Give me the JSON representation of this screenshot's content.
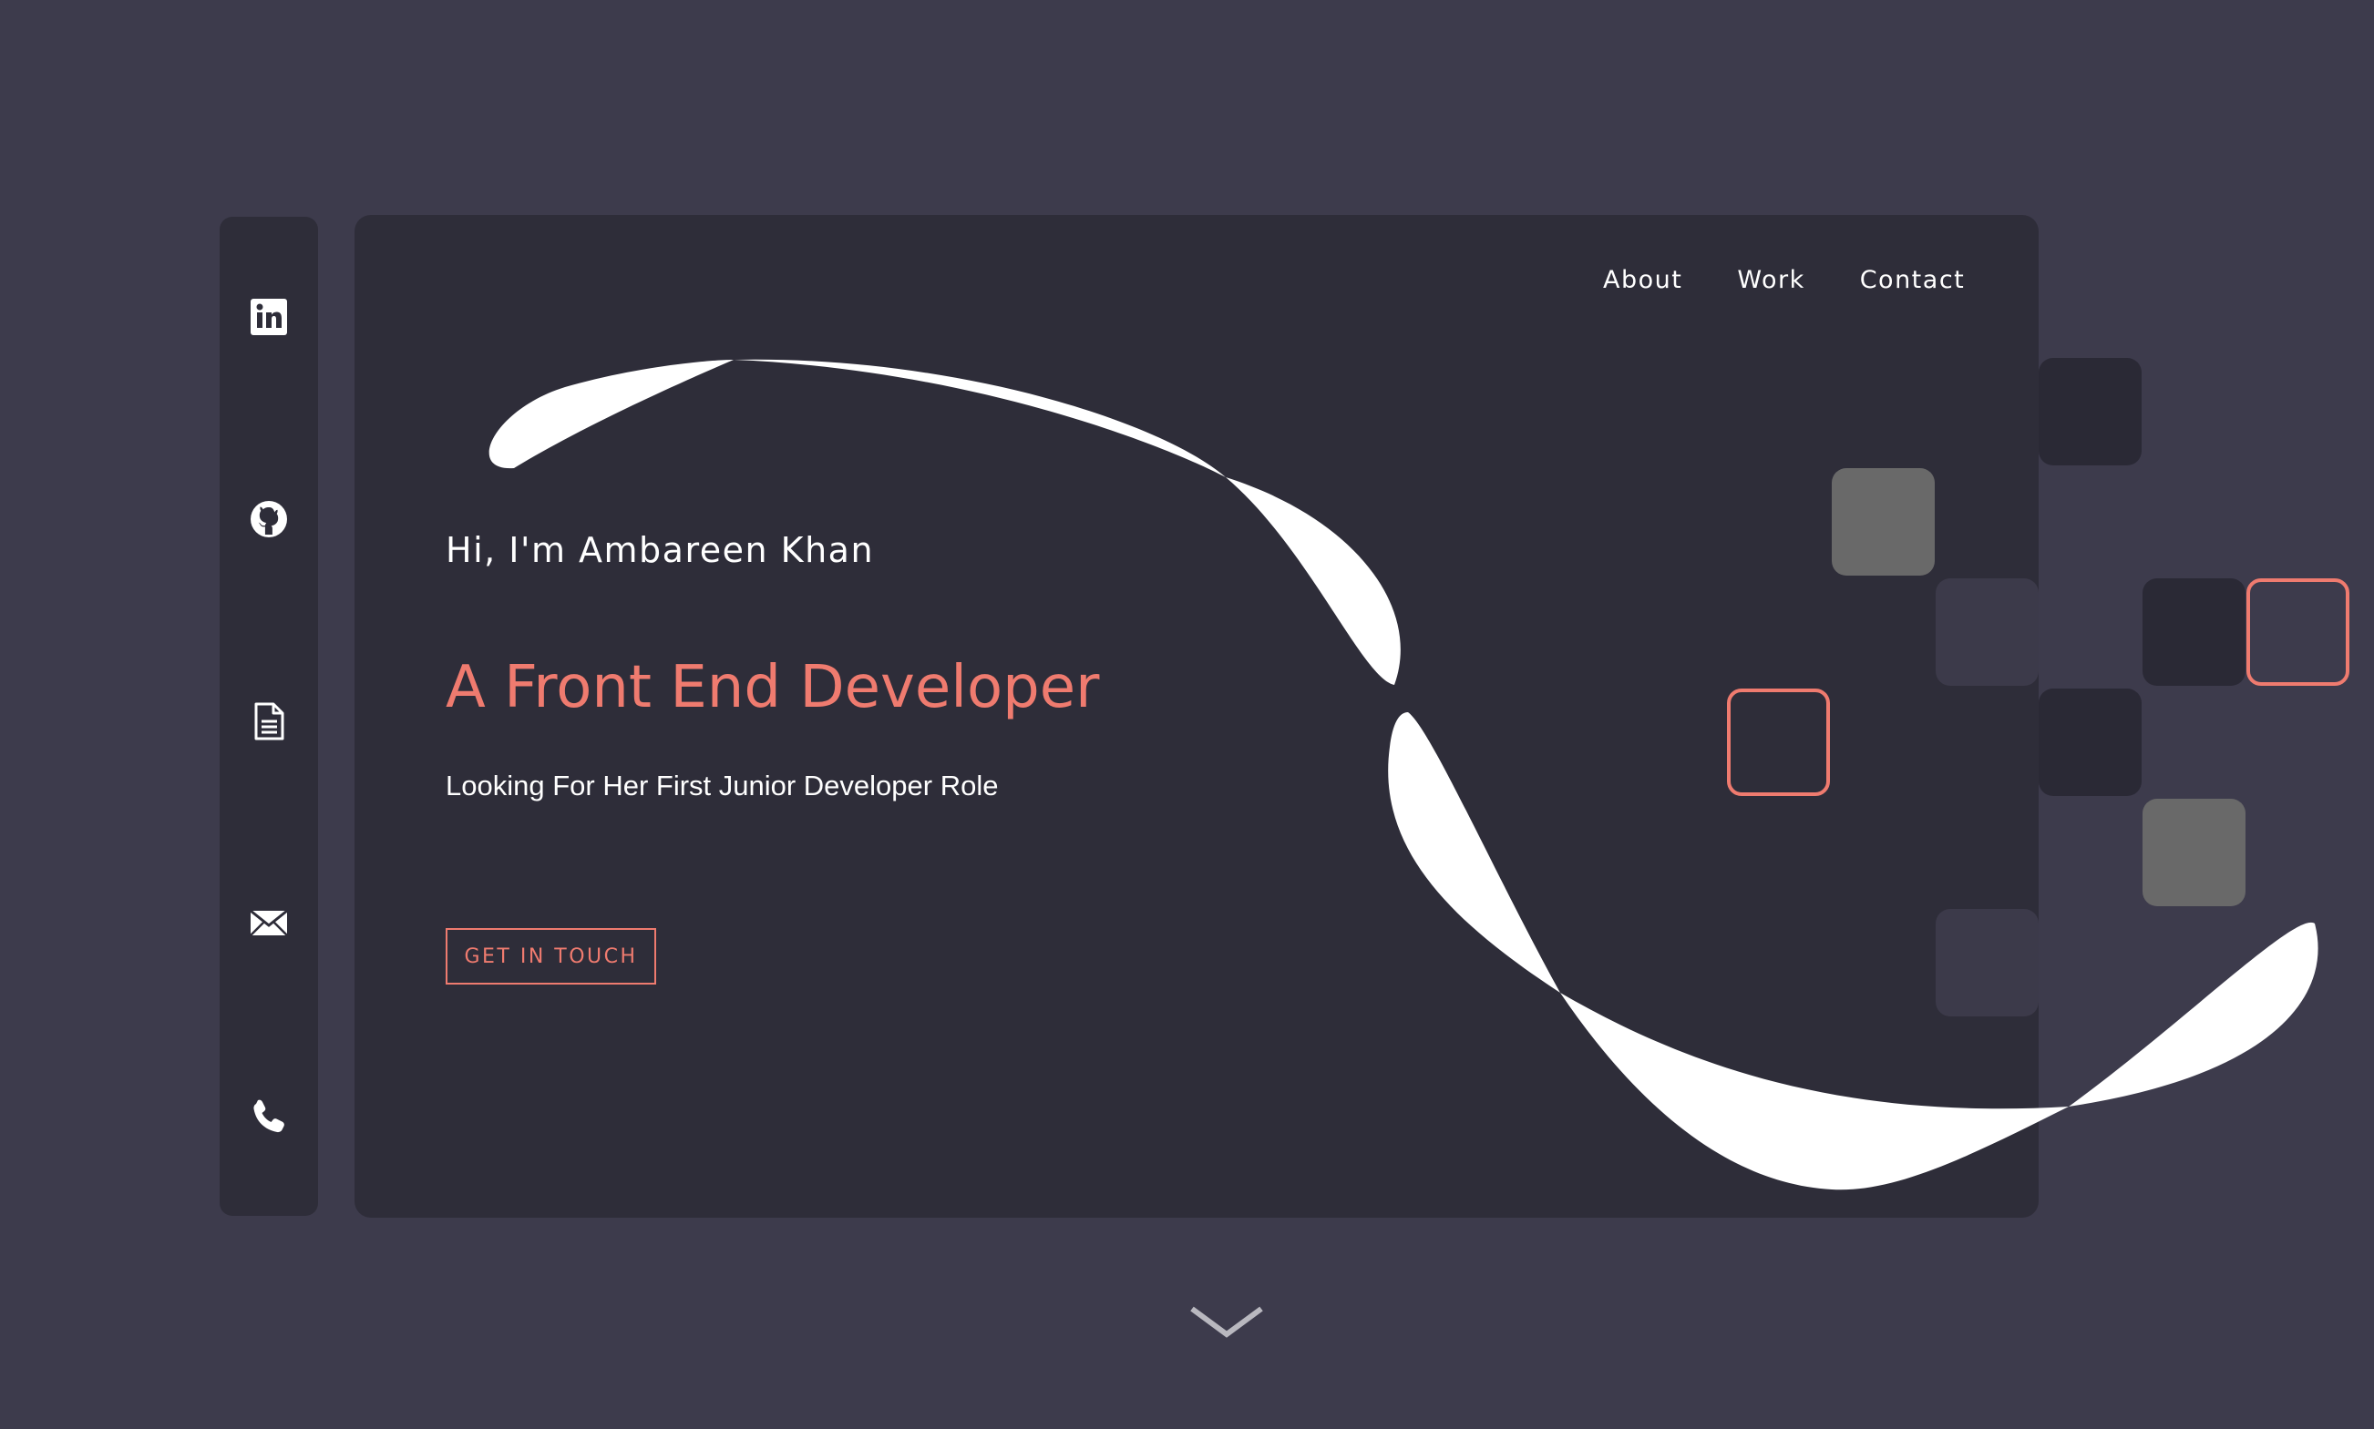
{
  "nav": {
    "items": [
      {
        "label": "About"
      },
      {
        "label": "Work"
      },
      {
        "label": "Contact"
      }
    ]
  },
  "hero": {
    "greeting": "Hi, I'm Ambareen Khan",
    "headline": "A Front End Developer",
    "tagline": "Looking For Her First Junior Developer Role",
    "cta_label": "GET IN TOUCH"
  },
  "social": {
    "icons": [
      "linkedin-icon",
      "github-icon",
      "document-icon",
      "email-icon",
      "phone-icon"
    ]
  },
  "colors": {
    "page_background": "#3d3b4c",
    "card_background": "#2e2d39",
    "accent": "#ef7b6f",
    "text": "#ffffff",
    "ribbon": "#ffffff",
    "tile_gray": "#696969",
    "tile_dark": "#2a2935",
    "tile_mid": "#3c3a4a"
  }
}
